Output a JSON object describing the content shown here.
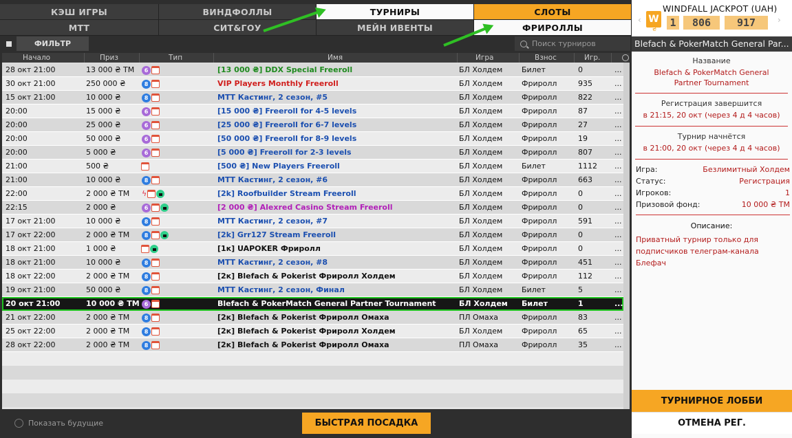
{
  "tabs_row1": [
    {
      "label": "КЭШ ИГРЫ",
      "style": "dark"
    },
    {
      "label": "ВИНДФОЛЛЫ",
      "style": "dark"
    },
    {
      "label": "ТУРНИРЫ",
      "style": "white"
    },
    {
      "label": "СЛОТЫ",
      "style": "orange"
    }
  ],
  "tabs_row2": [
    {
      "label": "МТТ",
      "style": "dark"
    },
    {
      "label": "СИТ&ГОУ",
      "style": "dark"
    },
    {
      "label": "МЕЙН ИВЕНТЫ",
      "style": "dark"
    },
    {
      "label": "ФРИРОЛЛЫ",
      "style": "white"
    }
  ],
  "filter": {
    "label": "ФИЛЬТР"
  },
  "search": {
    "placeholder": "Поиск турниров"
  },
  "columns": [
    "Начало",
    "Приз",
    "Тип",
    "Имя",
    "Игра",
    "Взнос",
    "Игр."
  ],
  "rows": [
    {
      "start": "28 окт 21:00",
      "prize": "13 000 ₴ TM",
      "icons": [
        "6",
        "cal"
      ],
      "name": "[13 000 ₴] DDX Special Freeroll",
      "color": "green",
      "game": "БЛ Холдем",
      "fee": "Билет",
      "players": "0"
    },
    {
      "start": "30 окт 21:00",
      "prize": "250 000 ₴",
      "icons": [
        "8",
        "cal"
      ],
      "name": "VIP Players Monthly Freeroll",
      "color": "red",
      "game": "БЛ Холдем",
      "fee": "Фриролл",
      "players": "935"
    },
    {
      "start": "15 окт 21:00",
      "prize": "10 000 ₴",
      "icons": [
        "8",
        "cal"
      ],
      "name": "МТТ Кастинг, 2 сезон, #5",
      "color": "blue",
      "game": "БЛ Холдем",
      "fee": "Фриролл",
      "players": "822"
    },
    {
      "start": "20:00",
      "prize": "15 000 ₴",
      "icons": [
        "6",
        "cal"
      ],
      "name": "[15 000 ₴] Freeroll for 4-5 levels",
      "color": "blue",
      "game": "БЛ Холдем",
      "fee": "Фриролл",
      "players": "87"
    },
    {
      "start": "20:00",
      "prize": "25 000 ₴",
      "icons": [
        "6",
        "cal"
      ],
      "name": "[25 000 ₴] Freeroll for 6-7 levels",
      "color": "blue",
      "game": "БЛ Холдем",
      "fee": "Фриролл",
      "players": "27"
    },
    {
      "start": "20:00",
      "prize": "50 000 ₴",
      "icons": [
        "6",
        "cal"
      ],
      "name": "[50 000 ₴] Freeroll for 8-9 levels",
      "color": "blue",
      "game": "БЛ Холдем",
      "fee": "Фриролл",
      "players": "19"
    },
    {
      "start": "20:00",
      "prize": "5 000 ₴",
      "icons": [
        "6",
        "cal"
      ],
      "name": "[5 000 ₴] Freeroll for 2-3 levels",
      "color": "blue",
      "game": "БЛ Холдем",
      "fee": "Фриролл",
      "players": "807"
    },
    {
      "start": "21:00",
      "prize": "500 ₴",
      "icons": [
        "cal"
      ],
      "name": "[500 ₴] New Players Freeroll",
      "color": "blue",
      "game": "БЛ Холдем",
      "fee": "Билет",
      "players": "1112"
    },
    {
      "start": "21:00",
      "prize": "10 000 ₴",
      "icons": [
        "8",
        "cal"
      ],
      "name": "МТТ Кастинг, 2 сезон, #6",
      "color": "blue",
      "game": "БЛ Холдем",
      "fee": "Фриролл",
      "players": "663"
    },
    {
      "start": "22:00",
      "prize": "2 000 ₴ TM",
      "icons": [
        "bolt",
        "cal",
        "lock"
      ],
      "name": "[2k] Roofbuilder Stream Freeroll",
      "color": "blue",
      "game": "БЛ Холдем",
      "fee": "Фриролл",
      "players": "0"
    },
    {
      "start": "22:15",
      "prize": "2 000 ₴",
      "icons": [
        "6",
        "cal",
        "lock"
      ],
      "name": "[2 000 ₴] Alexred Casino Stream Freeroll",
      "color": "magenta",
      "game": "БЛ Холдем",
      "fee": "Фриролл",
      "players": "0"
    },
    {
      "start": "17 окт 21:00",
      "prize": "10 000 ₴",
      "icons": [
        "8",
        "cal"
      ],
      "name": "МТТ Кастинг, 2 сезон, #7",
      "color": "blue",
      "game": "БЛ Холдем",
      "fee": "Фриролл",
      "players": "591"
    },
    {
      "start": "17 окт 22:00",
      "prize": "2 000 ₴ TM",
      "icons": [
        "8",
        "cal",
        "lock"
      ],
      "name": "[2k] Grr127 Stream Freeroll",
      "color": "blue",
      "game": "БЛ Холдем",
      "fee": "Фриролл",
      "players": "0"
    },
    {
      "start": "18 окт 21:00",
      "prize": "1 000 ₴",
      "icons": [
        "cal",
        "lock"
      ],
      "name": "[1к] UAPOKER Фриролл",
      "color": "plain",
      "game": "БЛ Холдем",
      "fee": "Фриролл",
      "players": "0"
    },
    {
      "start": "18 окт 21:00",
      "prize": "10 000 ₴",
      "icons": [
        "8",
        "cal"
      ],
      "name": "МТТ Кастинг, 2 сезон, #8",
      "color": "blue",
      "game": "БЛ Холдем",
      "fee": "Фриролл",
      "players": "451"
    },
    {
      "start": "18 окт 22:00",
      "prize": "2 000 ₴ TM",
      "icons": [
        "8",
        "cal"
      ],
      "name": "[2к] Blefach & Pokerist Фриролл Холдем",
      "color": "plain",
      "game": "БЛ Холдем",
      "fee": "Фриролл",
      "players": "112"
    },
    {
      "start": "19 окт 21:00",
      "prize": "50 000 ₴",
      "icons": [
        "8",
        "cal"
      ],
      "name": "МТТ Кастинг, 2 сезон, Финал",
      "color": "blue",
      "game": "БЛ Холдем",
      "fee": "Билет",
      "players": "5"
    },
    {
      "start": "20 окт 21:00",
      "prize": "10 000 ₴ TM",
      "icons": [
        "6",
        "cal"
      ],
      "name": "Blefach & PokerMatch General Partner Tournament",
      "color": "sel",
      "game": "БЛ Холдем",
      "fee": "Билет",
      "players": "1",
      "selected": true
    },
    {
      "start": "21 окт 22:00",
      "prize": "2 000 ₴ TM",
      "icons": [
        "8",
        "cal"
      ],
      "name": "[2к] Blefach & Pokerist Фриролл Омаха",
      "color": "plain",
      "game": "ПЛ Омаха",
      "fee": "Фриролл",
      "players": "83"
    },
    {
      "start": "25 окт 22:00",
      "prize": "2 000 ₴ TM",
      "icons": [
        "8",
        "cal"
      ],
      "name": "[2к] Blefach & Pokerist Фриролл Холдем",
      "color": "plain",
      "game": "БЛ Холдем",
      "fee": "Фриролл",
      "players": "65"
    },
    {
      "start": "28 окт 22:00",
      "prize": "2 000 ₴ TM",
      "icons": [
        "8",
        "cal"
      ],
      "name": "[2к] Blefach & Pokerist Фриролл Омаха",
      "color": "plain",
      "game": "ПЛ Омаха",
      "fee": "Фриролл",
      "players": "35"
    }
  ],
  "more": "...",
  "show_future": "Показать будущие",
  "quick_seat": "БЫСТРАЯ ПОСАДКА",
  "jackpot": {
    "title": "WINDFALL JACKPOT (UAH)",
    "logo": "W",
    "currency": "₴",
    "digits": [
      "1",
      "806",
      "917"
    ]
  },
  "details": {
    "title": "Blefach & PokerMatch General Par...",
    "name_label": "Название",
    "name_value": "Blefach & PokerMatch General Partner Tournament",
    "reg_end_label": "Регистрация завершится",
    "reg_end_value": "в 21:15, 20 окт (через 4 д 4 часов)",
    "start_label": "Турнир начнётся",
    "start_value": "в 21:00, 20 окт (через 4 д 4 часов)",
    "game_label": "Игра:",
    "game_value": "Безлимитный Холдем",
    "status_label": "Статус:",
    "status_value": "Регистрация",
    "players_label": "Игроков:",
    "players_value": "1",
    "prize_label": "Призовой фонд:",
    "prize_value": "10 000 ₴ TM",
    "desc_label": "Описание:",
    "desc_value": "Приватный турнир только для подписчиков телеграм-канала Блефач"
  },
  "lobby_btn": "ТУРНИРНОЕ ЛОББИ",
  "cancel_btn": "ОТМЕНА РЕГ."
}
